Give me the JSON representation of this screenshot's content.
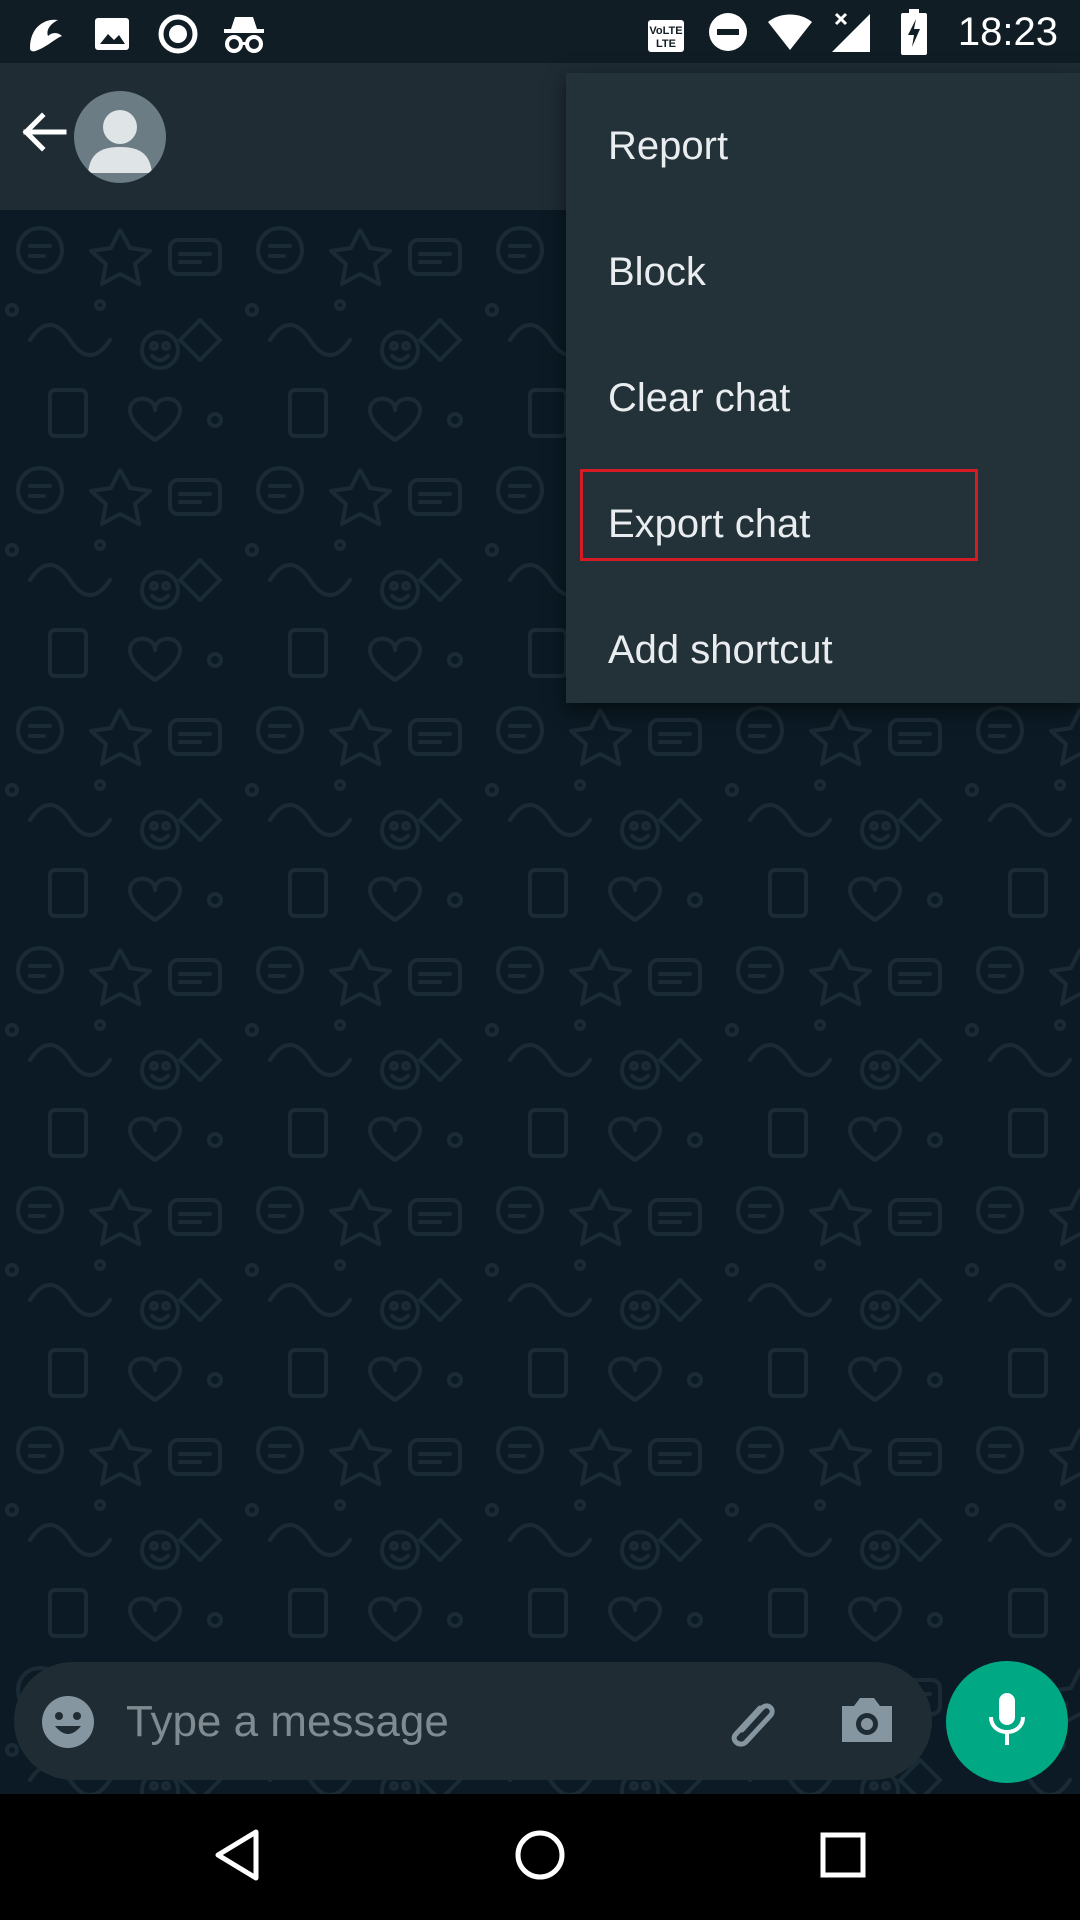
{
  "status_bar": {
    "time": "18:23",
    "left_icons": [
      "carrier-logo-icon",
      "image-icon",
      "record-icon",
      "incognito-icon"
    ],
    "right_icons": [
      "volte-icon",
      "dnd-icon",
      "wifi-icon",
      "signal-icon",
      "battery-charging-icon"
    ]
  },
  "app_bar": {
    "back_icon": "arrow-left-icon",
    "avatar_icon": "default-avatar-icon"
  },
  "menu": {
    "items": [
      {
        "label": "Report"
      },
      {
        "label": "Block"
      },
      {
        "label": "Clear chat"
      },
      {
        "label": "Export chat"
      },
      {
        "label": "Add shortcut"
      }
    ],
    "highlighted": "Export chat"
  },
  "composer": {
    "placeholder": "Type a message",
    "emoji_icon": "emoji-icon",
    "attach_icon": "paperclip-icon",
    "camera_icon": "camera-icon",
    "mic_icon": "microphone-icon"
  },
  "nav_bar": {
    "icons": [
      "nav-back-icon",
      "nav-home-icon",
      "nav-recents-icon"
    ]
  },
  "colors": {
    "status_bar": "#101d25",
    "app_bar": "#1f2c34",
    "chat_background": "#0b1a24",
    "menu_background": "#233138",
    "accent": "#00a884",
    "highlight_border": "#d51c24"
  }
}
